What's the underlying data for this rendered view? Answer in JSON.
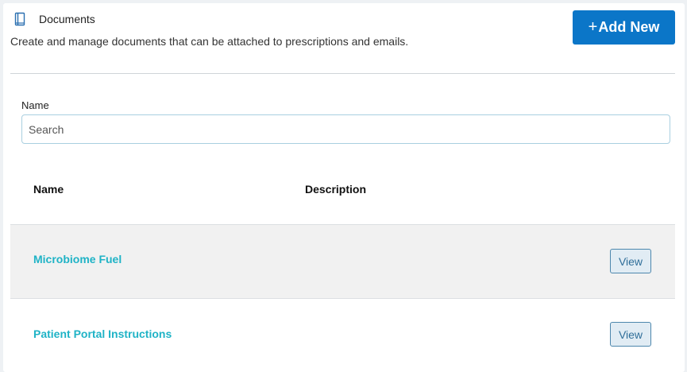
{
  "header": {
    "icon": "book-icon",
    "title": "Documents",
    "subtitle": "Create and manage documents that can be attached to prescriptions and emails.",
    "add_button": {
      "icon": "plus-icon",
      "plus": "+",
      "label": "Add New"
    }
  },
  "filter": {
    "name_label": "Name",
    "search_placeholder": "Search",
    "search_value": ""
  },
  "table": {
    "columns": [
      "Name",
      "Description"
    ],
    "rows": [
      {
        "name": "Microbiome Fuel",
        "description": "",
        "action": "View"
      },
      {
        "name": "Patient Portal Instructions",
        "description": "",
        "action": "View"
      }
    ]
  },
  "colors": {
    "accent": "#0b76c8",
    "link": "#1fb3c6",
    "row_alt": "#f1f1f1",
    "view_button_bg": "#e1ecf4"
  }
}
